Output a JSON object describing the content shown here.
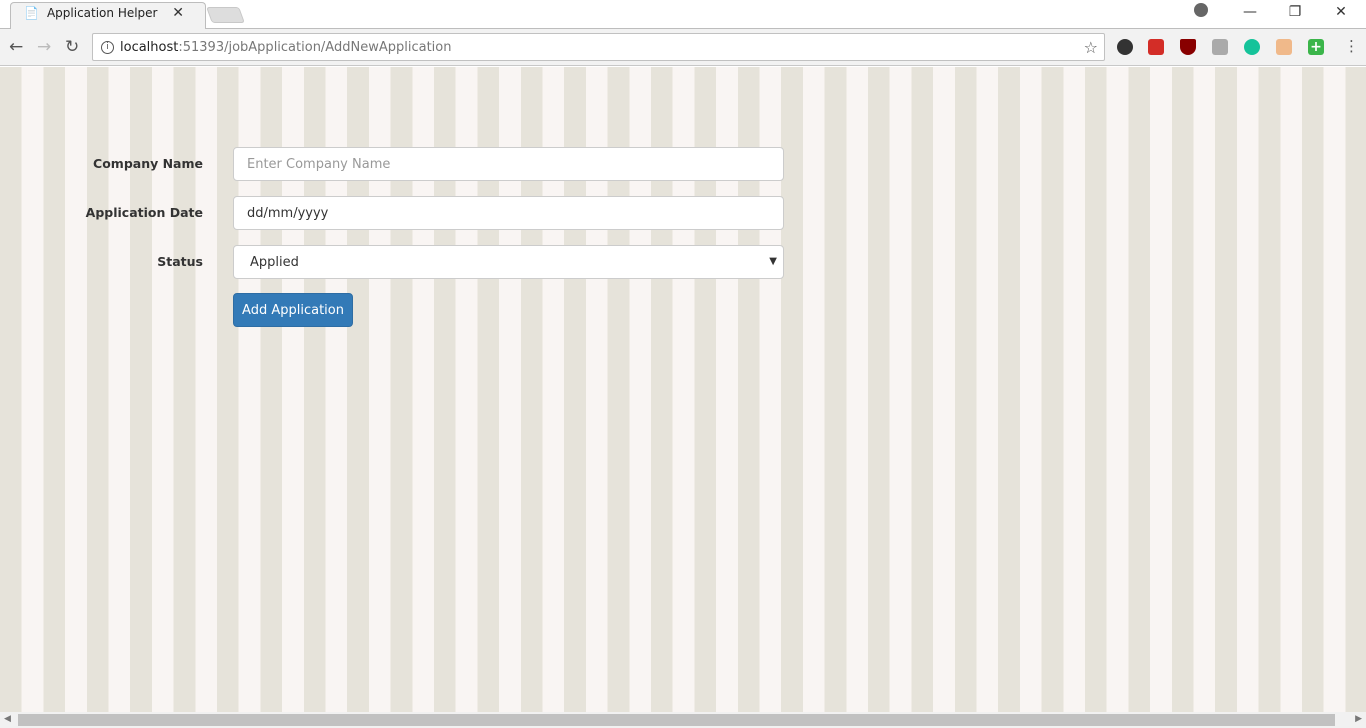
{
  "browser": {
    "tab_title": "Application Helper",
    "url_host": "localhost",
    "url_path": ":51393/jobApplication/AddNewApplication",
    "extensions": [
      "evernote-icon",
      "lastpass-icon",
      "ublock-icon",
      "extension-gray-icon",
      "grammarly-icon",
      "face-extension-icon",
      "plus-extension-icon"
    ]
  },
  "colors": {
    "stripe_dark": "#e6e3da",
    "stripe_light": "#f9f5f3",
    "primary": "#337ab7"
  },
  "form": {
    "company_label": "Company Name",
    "company_placeholder": "Enter Company Name",
    "date_label": "Application Date",
    "date_value": "dd/mm/yyyy",
    "status_label": "Status",
    "status_value": "Applied",
    "submit_label": "Add Application"
  }
}
